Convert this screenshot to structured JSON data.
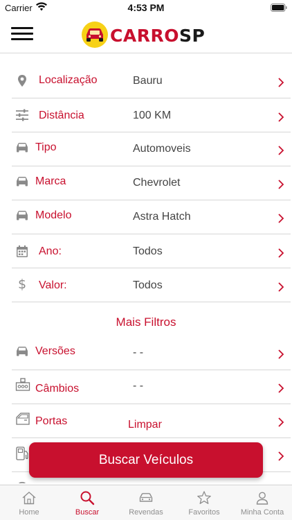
{
  "status_bar": {
    "carrier": "Carrier",
    "time": "4:53 PM"
  },
  "brand": {
    "name_part1": "CARRO",
    "name_part2": "SP",
    "accent": "#c8102e"
  },
  "filters": [
    {
      "label": "Localização",
      "value": "Bauru",
      "icon": "location-pin-icon"
    },
    {
      "label": "Distância",
      "value": "100 KM",
      "icon": "sliders-icon"
    },
    {
      "label": "Tipo",
      "value": "Automoveis",
      "icon": "car-icon"
    },
    {
      "label": "Marca",
      "value": "Chevrolet",
      "icon": "car-icon"
    },
    {
      "label": "Modelo",
      "value": "Astra Hatch",
      "icon": "car-icon"
    },
    {
      "label": "Ano:",
      "value": "Todos",
      "icon": "calendar-icon"
    },
    {
      "label": "Valor:",
      "value": "Todos",
      "icon": "dollar-icon"
    }
  ],
  "more_filters": {
    "title": "Mais Filtros",
    "items": [
      {
        "label": "Versões",
        "value": "- -",
        "icon": "car-icon"
      },
      {
        "label": "Câmbios",
        "value": "- -",
        "icon": "gearbox-icon"
      },
      {
        "label": "Portas",
        "value": "",
        "icon": "car-door-icon"
      }
    ]
  },
  "actions": {
    "clear_label": "Limpar",
    "search_label": "Buscar Veículos"
  },
  "tabs": [
    {
      "label": "Home",
      "icon": "home-icon",
      "active": false
    },
    {
      "label": "Buscar",
      "icon": "search-icon",
      "active": true
    },
    {
      "label": "Revendas",
      "icon": "car-front-icon",
      "active": false
    },
    {
      "label": "Favoritos",
      "icon": "star-icon",
      "active": false
    },
    {
      "label": "Minha Conta",
      "icon": "user-icon",
      "active": false
    }
  ]
}
